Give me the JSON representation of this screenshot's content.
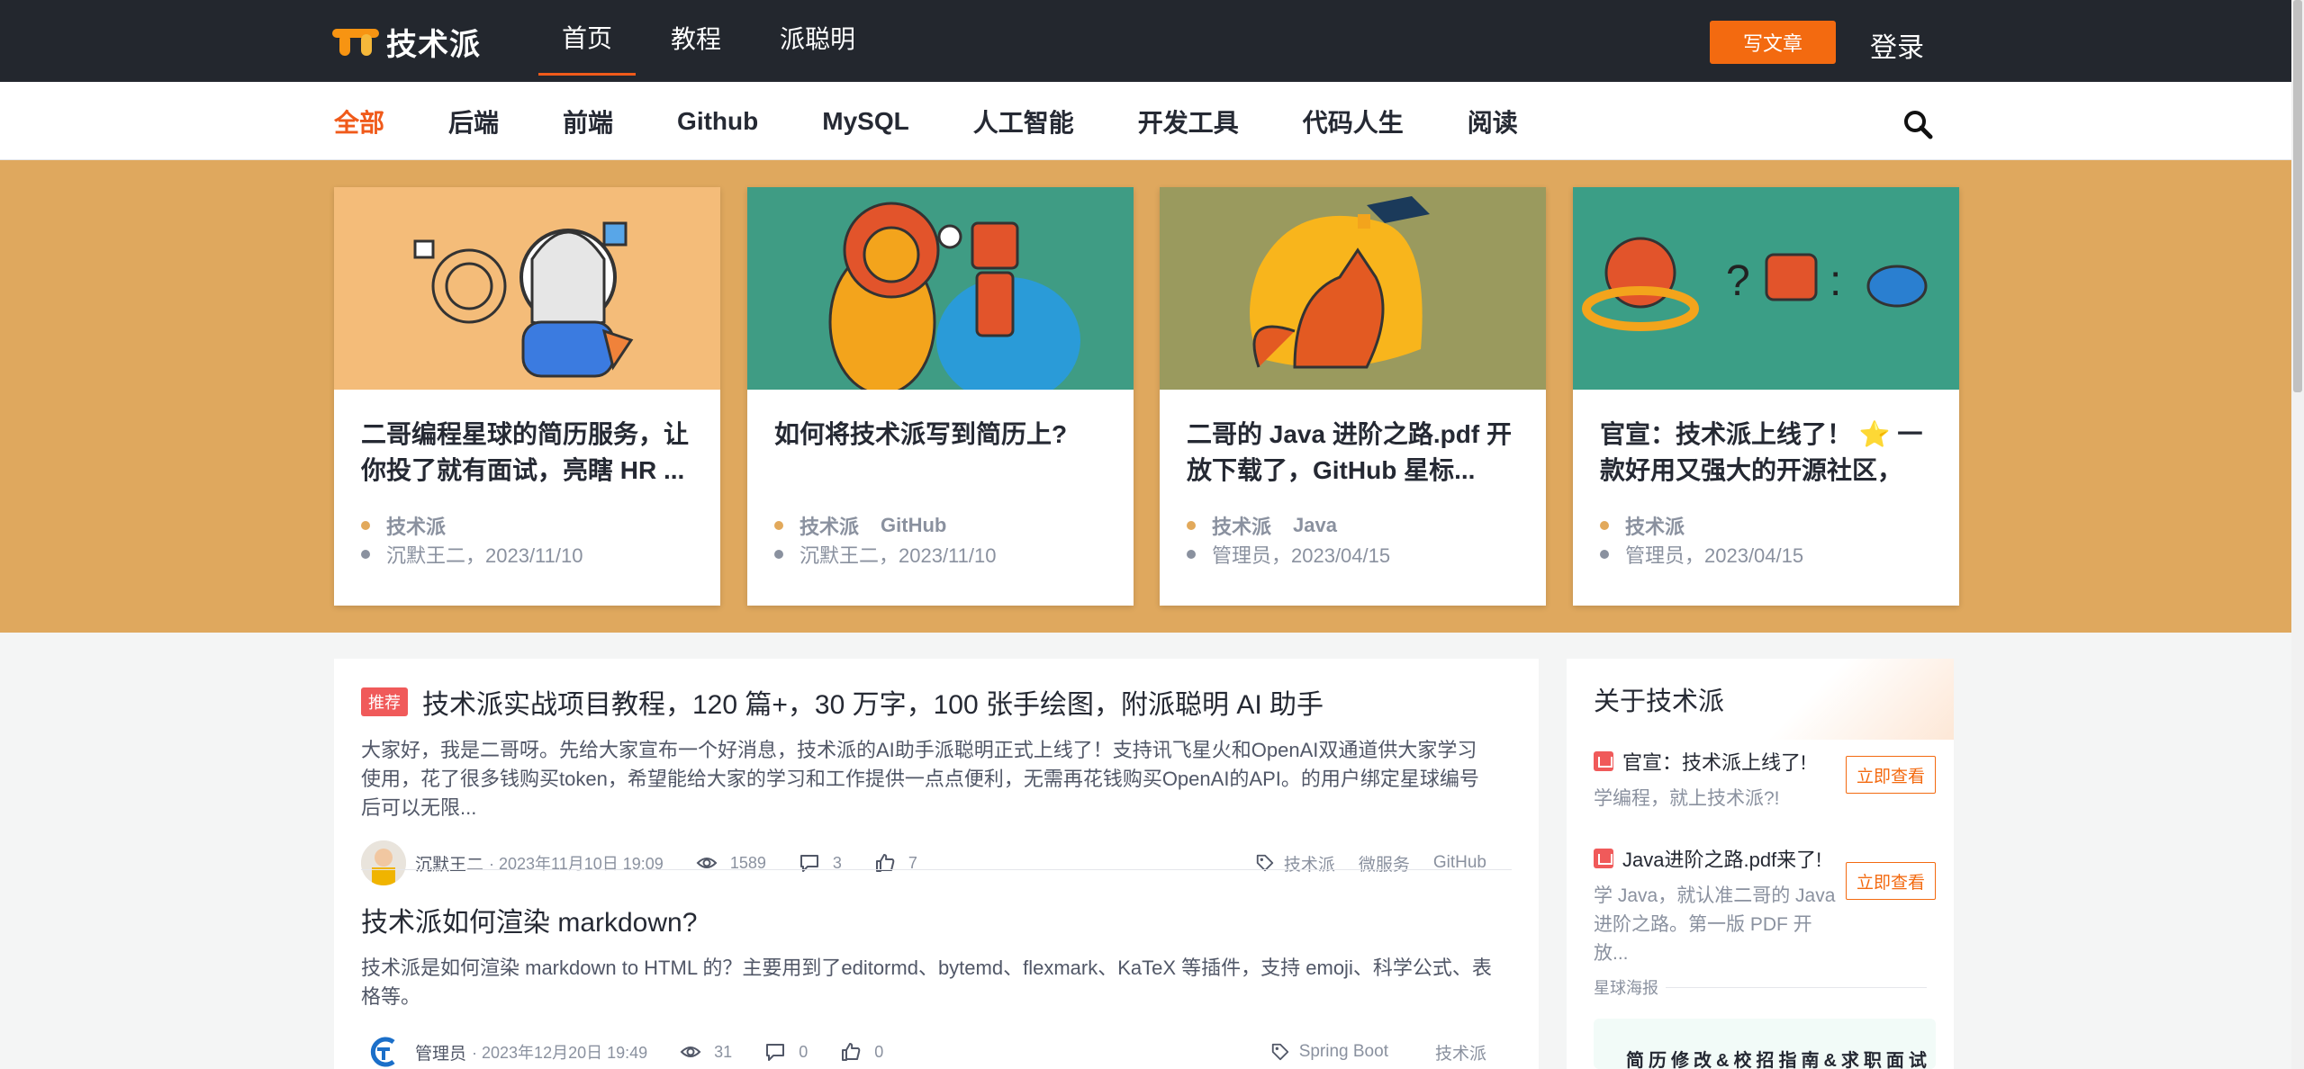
{
  "header": {
    "logo_text": "技术派",
    "nav": [
      "首页",
      "教程",
      "派聪明"
    ],
    "write_label": "写文章",
    "login_label": "登录"
  },
  "categories": [
    "全部",
    "后端",
    "前端",
    "Github",
    "MySQL",
    "人工智能",
    "开发工具",
    "代码人生",
    "阅读"
  ],
  "cards": [
    {
      "title": "二哥编程星球的简历服务，让你投了就有面试，亮瞎 HR ...",
      "tags": [
        "技术派"
      ],
      "author_date": "沉默王二，2023/11/10",
      "image_theme": "security-illustration"
    },
    {
      "title": "如何将技术派写到简历上?",
      "tags": [
        "技术派",
        "GitHub"
      ],
      "author_date": "沉默王二，2023/11/10",
      "image_theme": "lion-robot-illustration"
    },
    {
      "title": "二哥的 Java 进阶之路.pdf 开放下载了，GitHub 星标...",
      "tags": [
        "技术派",
        "Java"
      ],
      "author_date": "管理员，2023/04/15",
      "image_theme": "fox-bird-illustration"
    },
    {
      "title": "官宣：技术派上线了！ ⭐ 一款好用又强大的开源社区，学...",
      "tags": [
        "技术派"
      ],
      "author_date": "管理员，2023/04/15",
      "image_theme": "robots-illustration"
    }
  ],
  "articles": [
    {
      "badge": "推荐",
      "title": "技术派实战项目教程，120 篇+，30 万字，100 张手绘图，附派聪明 AI 助手",
      "desc": "大家好，我是二哥呀。先给大家宣布一个好消息，技术派的AI助手派聪明正式上线了！支持讯飞星火和OpenAI双通道供大家学习使用，花了很多钱购买token，希望能给大家的学习和工作提供一点点便利，无需再花钱购买OpenAI的API。的用户绑定星球编号后可以无限...",
      "author": "沉默王二",
      "date": "· 2023年11月10日 19:09",
      "views": "1589",
      "comments": "3",
      "likes": "7",
      "tags": [
        "技术派",
        "微服务",
        "GitHub"
      ]
    },
    {
      "badge": "",
      "title": "技术派如何渲染 markdown?",
      "desc": "技术派是如何渲染 markdown to HTML 的？主要用到了editormd、bytemd、flexmark、KaTeX 等插件，支持 emoji、科学公式、表格等。",
      "author": "管理员",
      "date": "· 2023年12月20日 19:49",
      "views": "31",
      "comments": "0",
      "likes": "0",
      "tags": [
        "Spring Boot",
        "技术派"
      ]
    }
  ],
  "sidebar": {
    "title": "关于技术派",
    "items": [
      {
        "title": "官宣：技术派上线了!",
        "desc": "学编程，就上技术派?!",
        "button": "立即查看"
      },
      {
        "title": "Java进阶之路.pdf来了!",
        "desc": "学 Java，就认准二哥的 Java 进阶之路。第一版 PDF 开放...",
        "button": "立即查看"
      }
    ],
    "poster_label": "星球海报",
    "poster_text": "简历修改&校招指南&求职面试"
  },
  "colors": {
    "accent": "#f05a1a",
    "topbar": "#23272e",
    "hero_bg": "#dfa85e",
    "tag_red": "#f05a5a"
  }
}
